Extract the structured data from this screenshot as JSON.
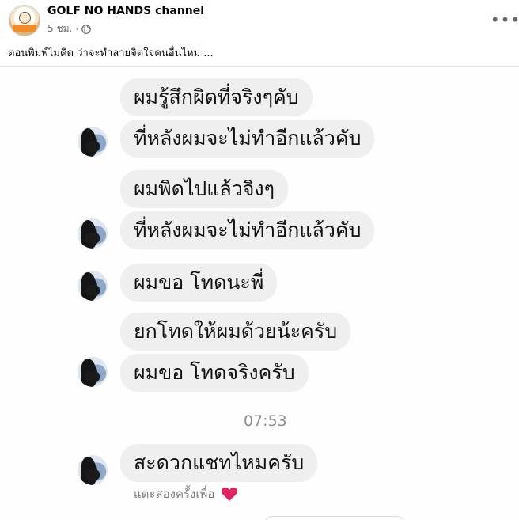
{
  "post": {
    "page_name": "GOLF NO HANDS channel",
    "time": "5 ชม.",
    "separator": "·",
    "caption": "ตอนพิมพ์ไม่คิด ว่าจะทำลายจิตใจคนอื่นไหม ...",
    "more_label": "•••",
    "avatar_icon": "page-logo",
    "privacy_icon": "globe-icon"
  },
  "chat": {
    "messages": [
      "ผมรู้สึกผิดที่จริงๆคับ",
      "ที่หลังผมจะไม่ทำอีกแล้วคับ",
      "ผมพิดไปแล้วจิงๆ",
      "ที่หลังผมจะไม่ทำอีกแล้วคับ",
      "ผมขอ โทดนะพี่",
      "ยกโทดให้ผมด้วยน้ะครับ",
      "ผมขอ โทดจริงครับ",
      "สะดวกแชทไหมครับ"
    ],
    "timestamp": "07:53",
    "reaction_hint": "แตะสองครั้งเพื่อ",
    "reaction_icon": "heart-icon",
    "heart_color": "#e0245e",
    "bubble_color": "#efefef"
  }
}
